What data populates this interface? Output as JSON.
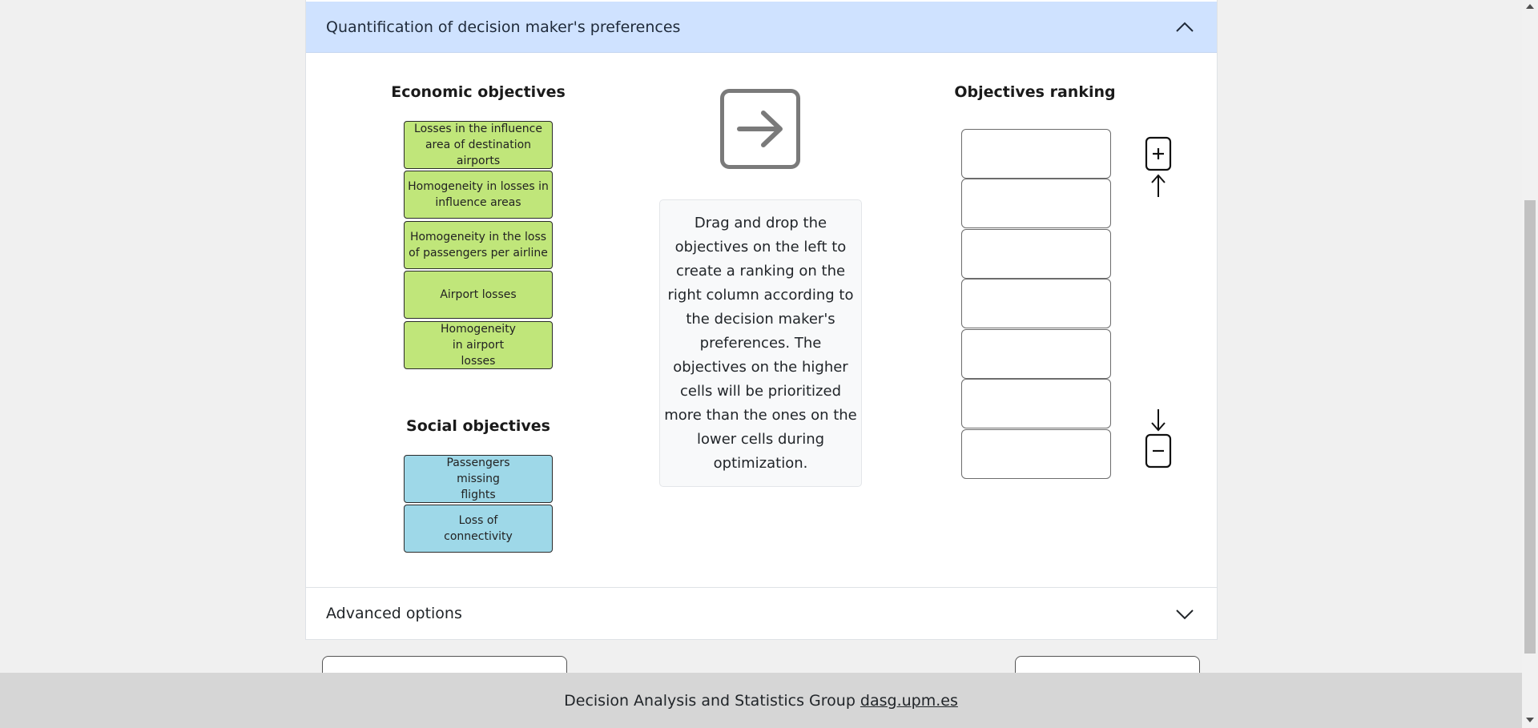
{
  "preferences_section": {
    "title": "Quantification of decision maker's preferences",
    "collapse_icon": "chevron-up-icon",
    "economic": {
      "title": "Economic objectives",
      "items": [
        "Losses in the influence area of destination airports",
        "Homogeneity in losses in influence areas",
        "Homogeneity in the loss of passengers per airline",
        "Airport losses",
        "Homogeneity in airport losses"
      ],
      "color": "#c0e67a"
    },
    "social": {
      "title": "Social objectives",
      "items": [
        "Passengers missing flights",
        "Loss of connectivity"
      ],
      "color": "#9ed8e8"
    },
    "drag_icon": "arrow-right-square-icon",
    "instructions": "Drag and drop the objectives on the left to create a ranking on the right column according to the decision maker's preferences. The objectives on the higher cells will be prioritized more than the ones on the lower cells during optimization.",
    "ranking": {
      "title": "Objectives ranking",
      "cells": [
        "",
        "",
        "",
        "",
        "",
        "",
        ""
      ],
      "increase_icon": "plus-square-arrow-up-icon",
      "decrease_icon": "arrow-down-minus-square-icon"
    }
  },
  "advanced_section": {
    "title": "Advanced options",
    "expand_icon": "chevron-down-icon"
  },
  "footer": {
    "text": "Decision Analysis and Statistics Group",
    "link": "dasg.upm.es"
  }
}
